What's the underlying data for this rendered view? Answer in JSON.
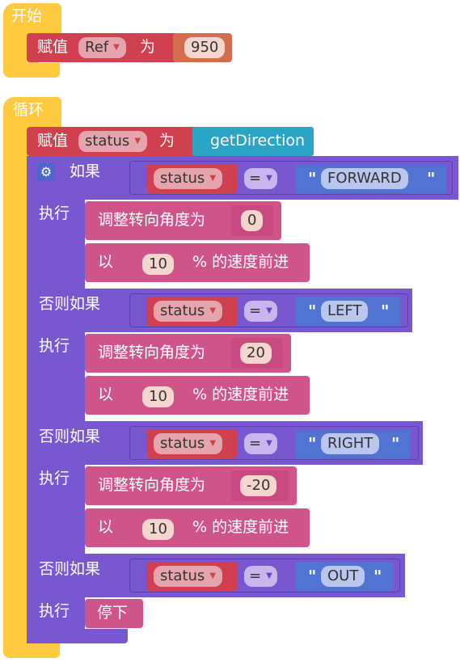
{
  "start": {
    "label": "开始",
    "assign": {
      "label": "赋值",
      "var": "Ref",
      "to": "为",
      "value": "950"
    }
  },
  "loop": {
    "label": "循环",
    "assign": {
      "label": "赋值",
      "var": "status",
      "to": "为",
      "func": "getDirection"
    },
    "if_label": "如果",
    "do_label": "执行",
    "elseif_label": "否则如果",
    "equals": "=",
    "branches": [
      {
        "var": "status",
        "string": "FORWARD",
        "turn_label": "调整转向角度为",
        "angle": "0",
        "speed_prefix": "以",
        "speed": "10",
        "speed_suffix": "% 的速度前进"
      },
      {
        "var": "status",
        "string": "LEFT",
        "turn_label": "调整转向角度为",
        "angle": "20",
        "speed_prefix": "以",
        "speed": "10",
        "speed_suffix": "% 的速度前进"
      },
      {
        "var": "status",
        "string": "RIGHT",
        "turn_label": "调整转向角度为",
        "angle": "-20",
        "speed_prefix": "以",
        "speed": "10",
        "speed_suffix": "% 的速度前进"
      },
      {
        "var": "status",
        "string": "OUT",
        "stop_label": "停下"
      }
    ]
  },
  "colors": {
    "event": "#ffc940",
    "variable": "#d0404f",
    "logic": "#7857d1",
    "motion": "#cf5489",
    "function": "#2ba4c5",
    "number": "#d26e4d",
    "string": "#5174d2"
  },
  "icons": {
    "mutator": "gear-icon",
    "dropdown": "triangle-down-icon"
  }
}
